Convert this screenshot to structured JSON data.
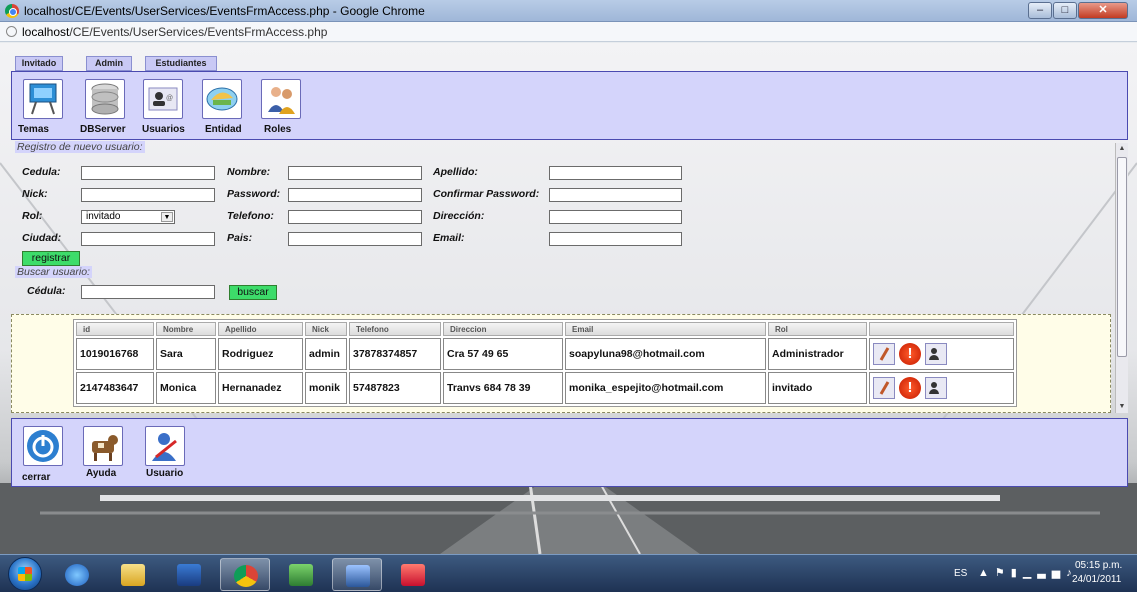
{
  "window": {
    "title": "localhost/CE/Events/UserServices/EventsFrmAccess.php - Google Chrome",
    "url_host": "localhost",
    "url_path": "/CE/Events/UserServices/EventsFrmAccess.php",
    "controls": {
      "minimize": "–",
      "maximize": "□",
      "close": "✕"
    }
  },
  "tabs": [
    "Invitado",
    "Admin",
    "Estudiantes"
  ],
  "menu": [
    "Temas",
    "DBServer",
    "Usuarios",
    "Entidad",
    "Roles"
  ],
  "registro": {
    "legend": "Registro de nuevo usuario:",
    "labels": {
      "cedula": "Cedula:",
      "nombre": "Nombre:",
      "apellido": "Apellido:",
      "nick": "Nick:",
      "password": "Password:",
      "confirmar": "Confirmar Password:",
      "rol": "Rol:",
      "telefono": "Telefono:",
      "direccion": "Dirección:",
      "ciudad": "Ciudad:",
      "pais": "Pais:",
      "email": "Email:"
    },
    "rol_selected": "invitado",
    "register_button": "registrar"
  },
  "buscar": {
    "legend": "Buscar usuario:",
    "cedula_label": "Cédula:",
    "search_button": "buscar"
  },
  "table": {
    "headers": [
      "id",
      "Nombre",
      "Apellido",
      "Nick",
      "Telefono",
      "Direccion",
      "Email",
      "Rol",
      ""
    ],
    "rows": [
      [
        "1019016768",
        "Sara",
        "Rodriguez",
        "admin",
        "37878374857",
        "Cra 57 49 65",
        "soapyluna98@hotmail.com",
        "Administrador"
      ],
      [
        "2147483647",
        "Monica",
        "Hernanadez",
        "monik",
        "57487823",
        "Tranvs 684 78 39",
        "monika_espejito@hotmail.com",
        "invitado"
      ]
    ],
    "delete_glyph": "!"
  },
  "bottom": [
    "cerrar",
    "Ayuda",
    "Usuario"
  ],
  "taskbar": {
    "lang": "ES",
    "time": "05:15 p.m.",
    "date": "24/01/2011"
  }
}
